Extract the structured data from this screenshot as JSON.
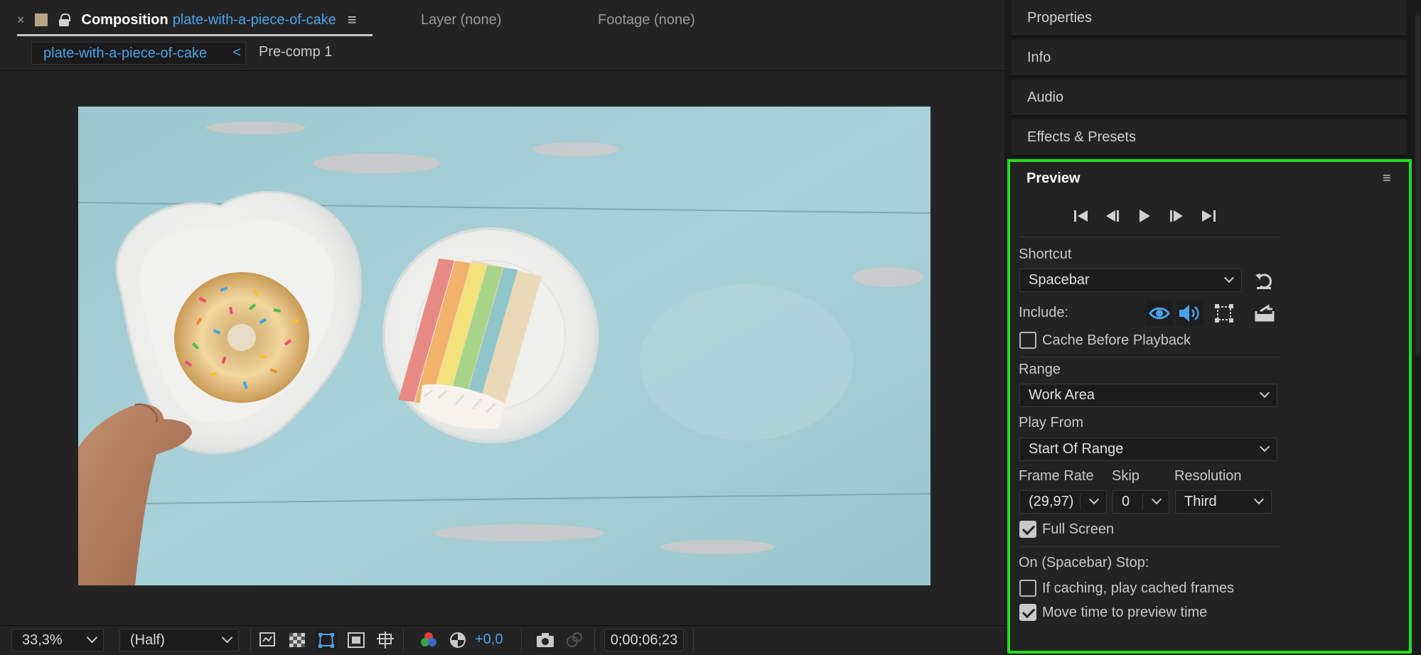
{
  "composition_panel": {
    "tab": {
      "close": "×",
      "prefix": "Composition",
      "name": "plate-with-a-piece-of-cake",
      "menu": "≡"
    },
    "other_tabs": {
      "layer": "Layer (none)",
      "footage": "Footage (none)"
    },
    "breadcrumb": {
      "active": "plate-with-a-piece-of-cake",
      "chevron": "<",
      "next": "Pre-comp 1"
    },
    "viewer": {
      "image_description_icon": "image-preview"
    }
  },
  "viewer_toolbar": {
    "zoom": "33,3%",
    "resolution": "(Half)",
    "exposure_value": "+0,0",
    "timecode": "0;00;06;23",
    "icons": [
      "always-preview-icon",
      "transparency-grid-icon",
      "mask-path-icon",
      "title-safe-icon",
      "grid-guides-icon",
      "color-channels-icon",
      "reset-exposure-icon",
      "snapshot-icon",
      "show-snapshot-icon"
    ]
  },
  "right_panels": {
    "properties": "Properties",
    "info": "Info",
    "audio": "Audio",
    "effects": "Effects & Presets"
  },
  "preview": {
    "title": "Preview",
    "menu": "≡",
    "highlight_color": "#22e01a",
    "accent_color": "#4aa3e8",
    "shortcut_label": "Shortcut",
    "shortcut_value": "Spacebar",
    "include_label": "Include:",
    "cache_before_playback": {
      "label": "Cache Before Playback",
      "checked": false
    },
    "range_label": "Range",
    "range_value": "Work Area",
    "play_from_label": "Play From",
    "play_from_value": "Start Of Range",
    "frame_rate_label": "Frame Rate",
    "frame_rate_value": "(29,97)",
    "skip_label": "Skip",
    "skip_value": "0",
    "resolution_label": "Resolution",
    "resolution_value": "Third",
    "full_screen": {
      "label": "Full Screen",
      "checked": true
    },
    "stop_label": "On (Spacebar) Stop:",
    "if_caching": {
      "label": "If caching, play cached frames",
      "checked": false
    },
    "move_time": {
      "label": "Move time to preview time",
      "checked": true
    }
  }
}
